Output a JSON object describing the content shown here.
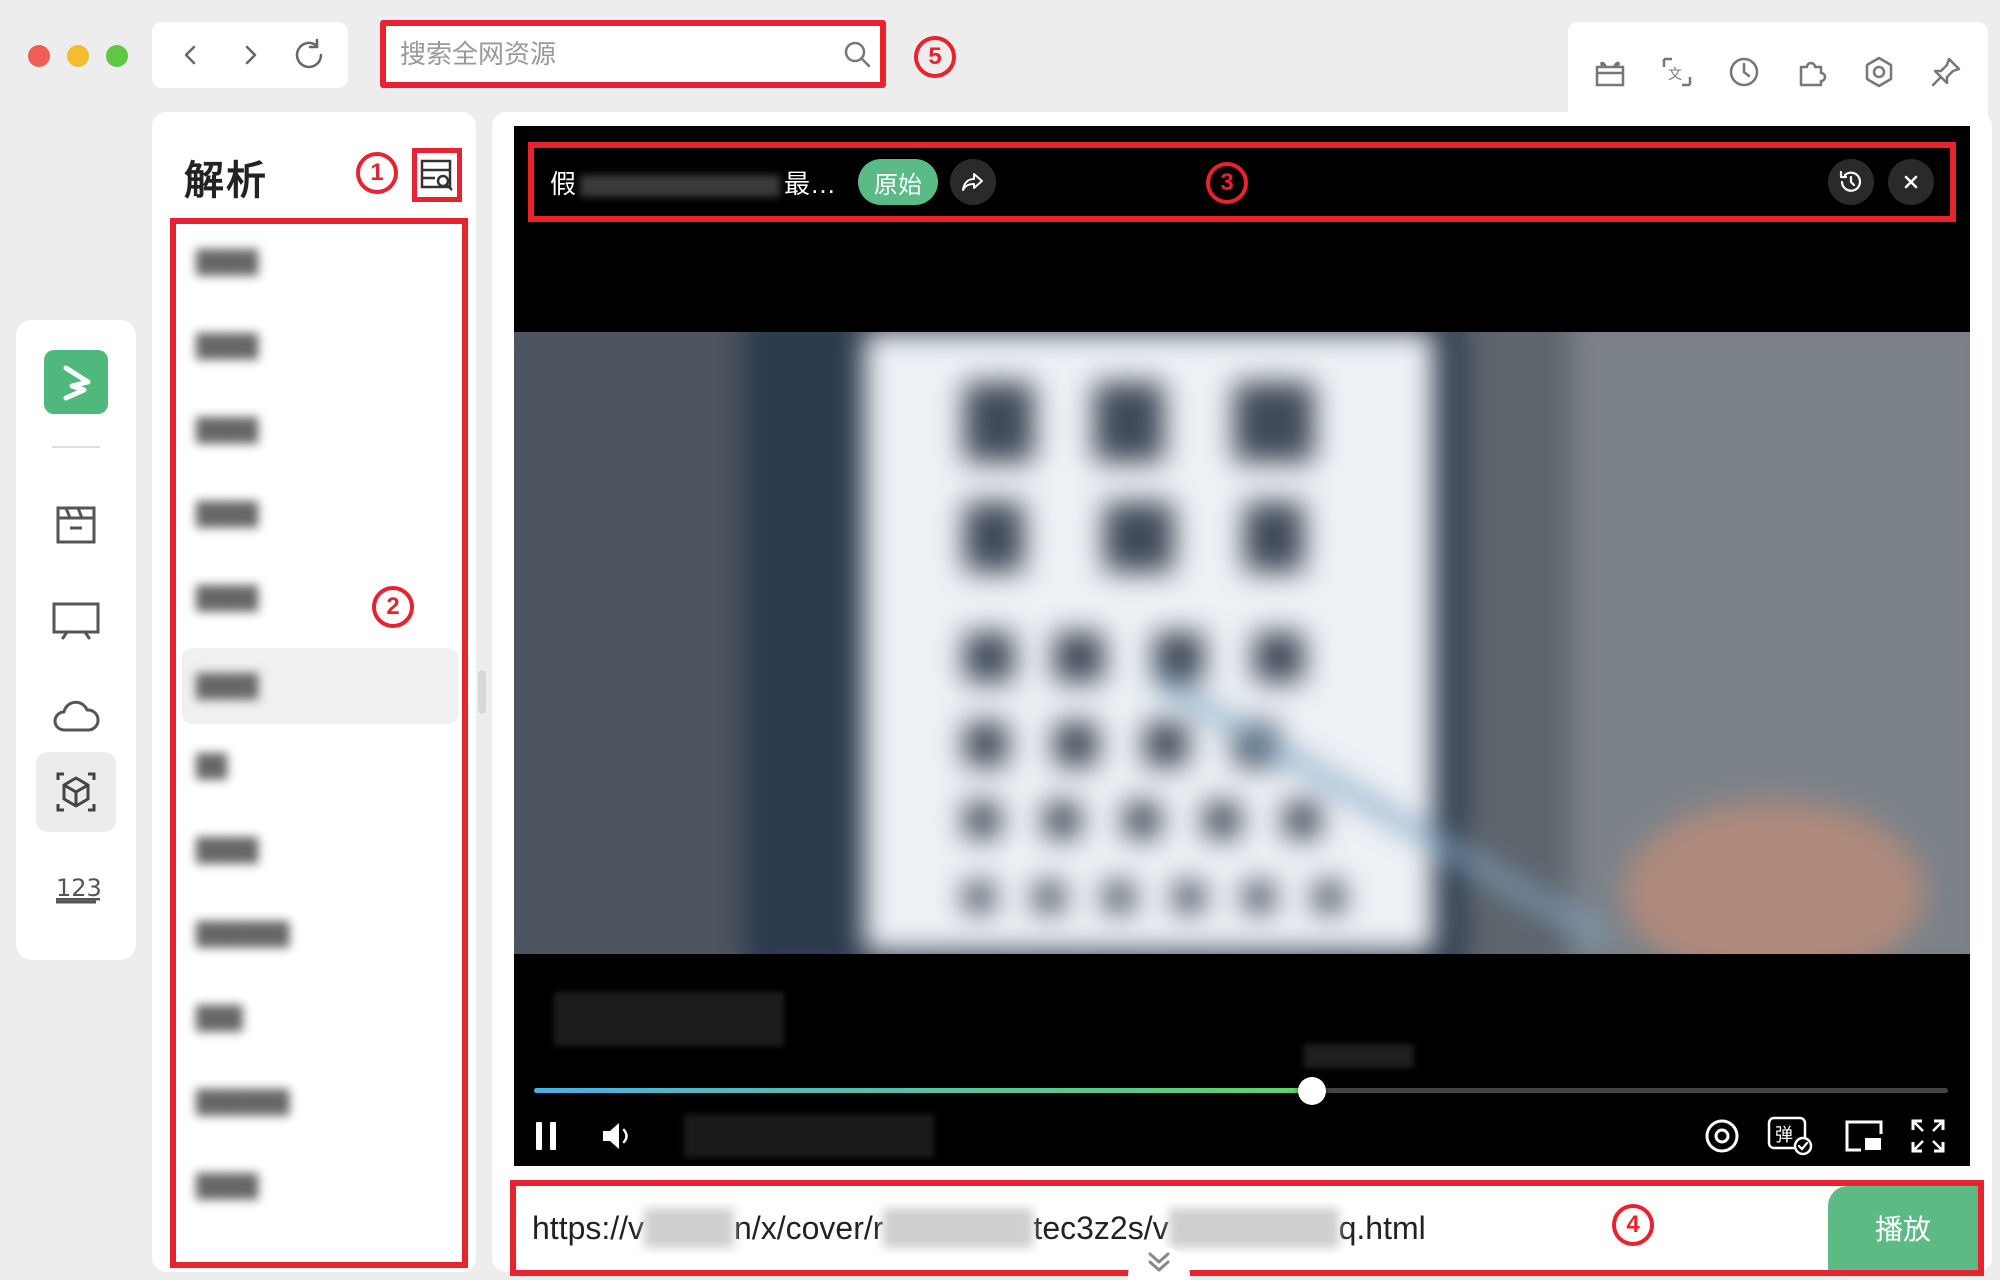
{
  "window": {
    "controls": [
      "close",
      "minimize",
      "maximize"
    ]
  },
  "nav": {
    "back_icon": "chevron-left-icon",
    "forward_icon": "chevron-right-icon",
    "refresh_icon": "refresh-icon"
  },
  "search": {
    "placeholder": "搜索全网资源",
    "value": ""
  },
  "badges": {
    "b1": "1",
    "b2": "2",
    "b3": "3",
    "b4": "4",
    "b5": "5"
  },
  "toolbar": {
    "icons": [
      "gift-icon",
      "translate-icon",
      "history-icon",
      "extension-icon",
      "settings-icon",
      "pin-icon"
    ]
  },
  "rail": {
    "items": [
      "film-icon",
      "tv-icon",
      "cloud-icon",
      "parse-cube-icon",
      "numbers-icon"
    ],
    "active": "parse-cube-icon"
  },
  "parse_panel": {
    "title": "解析",
    "items_count_visible": 12
  },
  "player": {
    "title_start": "假",
    "title_end": "最…",
    "original_button": "原始",
    "progress": 0.55
  },
  "url_bar": {
    "seg1": "https://v",
    "seg2": "n/x/cover/r",
    "seg3": "tec3z2s/v",
    "seg4": "q.html",
    "play_label": "播放"
  },
  "colors": {
    "accent": "#5abb86",
    "annotation": "#e8222e",
    "progress_start": "#4bb0e0",
    "progress_end": "#5fd36a"
  }
}
